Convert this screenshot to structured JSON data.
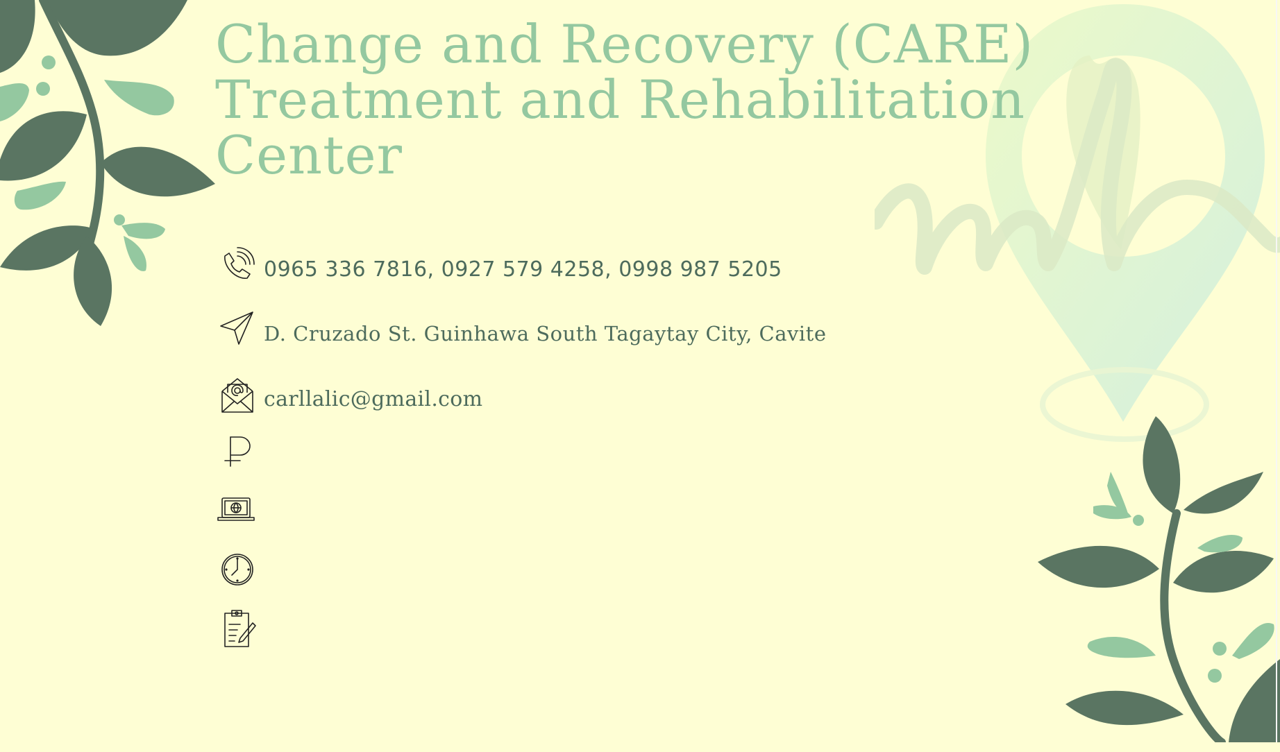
{
  "title": "Change and Recovery (CARE) Treatment and Rehabilitation Center",
  "contact": {
    "phone": "0965 336 7816, 0927 579 4258, 0998 987 5205",
    "address": "D. Cruzado St. Guinhawa South Tagaytay City, Cavite",
    "email": "carllalic@gmail.com"
  },
  "colors": {
    "background": "#fefed4",
    "title": "#94c8a0",
    "text": "#4d6b5c",
    "leaf_dark": "#5a7562",
    "leaf_light": "#94c8a0"
  },
  "icons": {
    "phone": "phone-icon",
    "address": "navigation-arrow-icon",
    "email": "email-envelope-icon",
    "price": "peso-icon",
    "website": "laptop-globe-icon",
    "hours": "clock-icon",
    "notes": "clipboard-pencil-icon",
    "watermark": "map-pin-logo"
  }
}
